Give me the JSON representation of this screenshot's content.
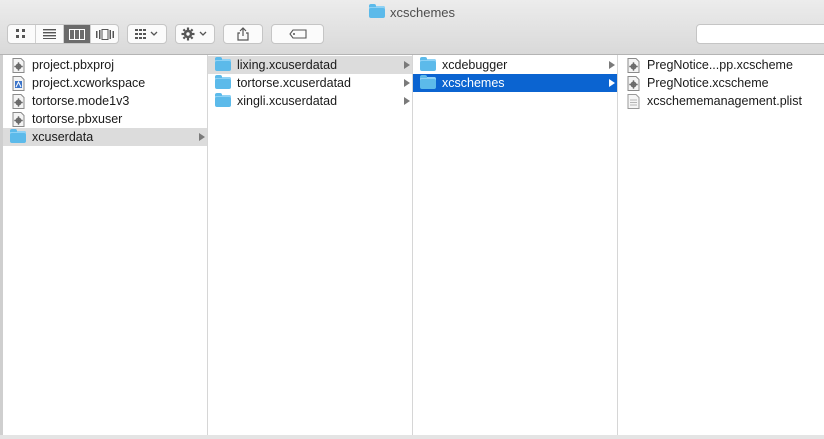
{
  "window": {
    "title": "xcschemes",
    "title_icon": "folder-icon"
  },
  "toolbar": {
    "view_modes": [
      "icon-view-icon",
      "list-view-icon",
      "column-view-icon",
      "cover-flow-icon"
    ],
    "active_view": "column-view-icon",
    "arrange_icon": "arrange-grid-icon",
    "action_icon": "gear-icon",
    "share_icon": "share-icon",
    "tag_icon": "tag-icon",
    "search_placeholder": ""
  },
  "columns": [
    {
      "items": [
        {
          "label": "project.pbxproj",
          "icon": "document-gear-icon",
          "has_children": false,
          "selected": "none"
        },
        {
          "label": "project.xcworkspace",
          "icon": "workspace-document-icon",
          "has_children": false,
          "selected": "none"
        },
        {
          "label": "tortorse.mode1v3",
          "icon": "document-gear-icon",
          "has_children": false,
          "selected": "none"
        },
        {
          "label": "tortorse.pbxuser",
          "icon": "document-gear-icon",
          "has_children": false,
          "selected": "none"
        },
        {
          "label": "xcuserdata",
          "icon": "folder-icon",
          "has_children": true,
          "selected": "gray"
        }
      ]
    },
    {
      "items": [
        {
          "label": "lixing.xcuserdatad",
          "icon": "folder-icon",
          "has_children": true,
          "selected": "gray"
        },
        {
          "label": "tortorse.xcuserdatad",
          "icon": "folder-icon",
          "has_children": true,
          "selected": "none"
        },
        {
          "label": "xingli.xcuserdatad",
          "icon": "folder-icon",
          "has_children": true,
          "selected": "none"
        }
      ]
    },
    {
      "items": [
        {
          "label": "xcdebugger",
          "icon": "folder-icon",
          "has_children": true,
          "selected": "none"
        },
        {
          "label": "xcschemes",
          "icon": "folder-icon",
          "has_children": true,
          "selected": "blue"
        }
      ]
    },
    {
      "items": [
        {
          "label": "PregNotice...pp.xcscheme",
          "icon": "document-gear-icon",
          "has_children": false,
          "selected": "none"
        },
        {
          "label": "PregNotice.xcscheme",
          "icon": "document-gear-icon",
          "has_children": false,
          "selected": "none"
        },
        {
          "label": "xcschememanagement.plist",
          "icon": "plist-document-icon",
          "has_children": false,
          "selected": "none"
        }
      ]
    }
  ],
  "colors": {
    "selection_blue": "#0b64d1",
    "selection_gray": "#dcdcdc",
    "folder_blue": "#5cbaea"
  }
}
